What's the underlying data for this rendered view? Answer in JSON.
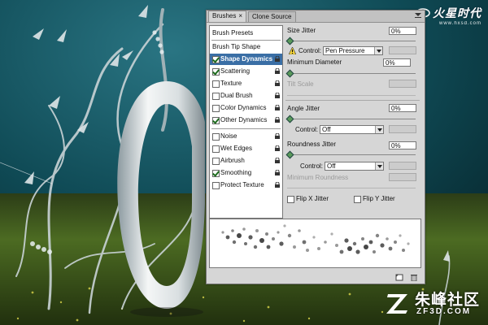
{
  "panel": {
    "tabs": [
      {
        "label": "Brushes",
        "close": "×"
      },
      {
        "label": "Clone Source"
      }
    ],
    "menu_icon": "panel-menu-icon",
    "left_items": [
      {
        "label": "Brush Presets",
        "type": "header"
      },
      {
        "label": "Brush Tip Shape",
        "type": "header"
      },
      {
        "label": "Shape Dynamics",
        "checked": true,
        "selected": true
      },
      {
        "label": "Scattering",
        "checked": true
      },
      {
        "label": "Texture",
        "checked": false
      },
      {
        "label": "Dual Brush",
        "checked": false
      },
      {
        "label": "Color Dynamics",
        "checked": false
      },
      {
        "label": "Other Dynamics",
        "checked": true
      },
      {
        "label": "Noise",
        "checked": false
      },
      {
        "label": "Wet Edges",
        "checked": false
      },
      {
        "label": "Airbrush",
        "checked": false
      },
      {
        "label": "Smoothing",
        "checked": true
      },
      {
        "label": "Protect Texture",
        "checked": false
      }
    ],
    "size_jitter": {
      "label": "Size Jitter",
      "value": "0%"
    },
    "size_control": {
      "label": "Control:",
      "value": "Pen Pressure"
    },
    "minimum_diameter": {
      "label": "Minimum Diameter",
      "value": "0%"
    },
    "tilt_scale": {
      "label": "Tilt Scale"
    },
    "angle_jitter": {
      "label": "Angle Jitter",
      "value": "0%"
    },
    "angle_control": {
      "label": "Control:",
      "value": "Off"
    },
    "roundness_jitter": {
      "label": "Roundness Jitter",
      "value": "0%"
    },
    "roundness_control": {
      "label": "Control:",
      "value": "Off"
    },
    "minimum_roundness": {
      "label": "Minimum Roundness"
    },
    "flip_x": {
      "label": "Flip X Jitter",
      "checked": false
    },
    "flip_y": {
      "label": "Flip Y Jitter",
      "checked": false
    },
    "footer_icons": [
      "new-brush-icon",
      "trash-icon"
    ]
  },
  "watermark_top": {
    "logo": "火星时代",
    "url": "www.hxsd.com"
  },
  "watermark_bottom": {
    "logo": "朱峰社区",
    "url": "ZF3D.COM"
  },
  "colors": {
    "sky": "#0f4a55",
    "grass": "#3c5a20",
    "panel": "#d6d6d6",
    "selection": "#3a6ea5"
  }
}
